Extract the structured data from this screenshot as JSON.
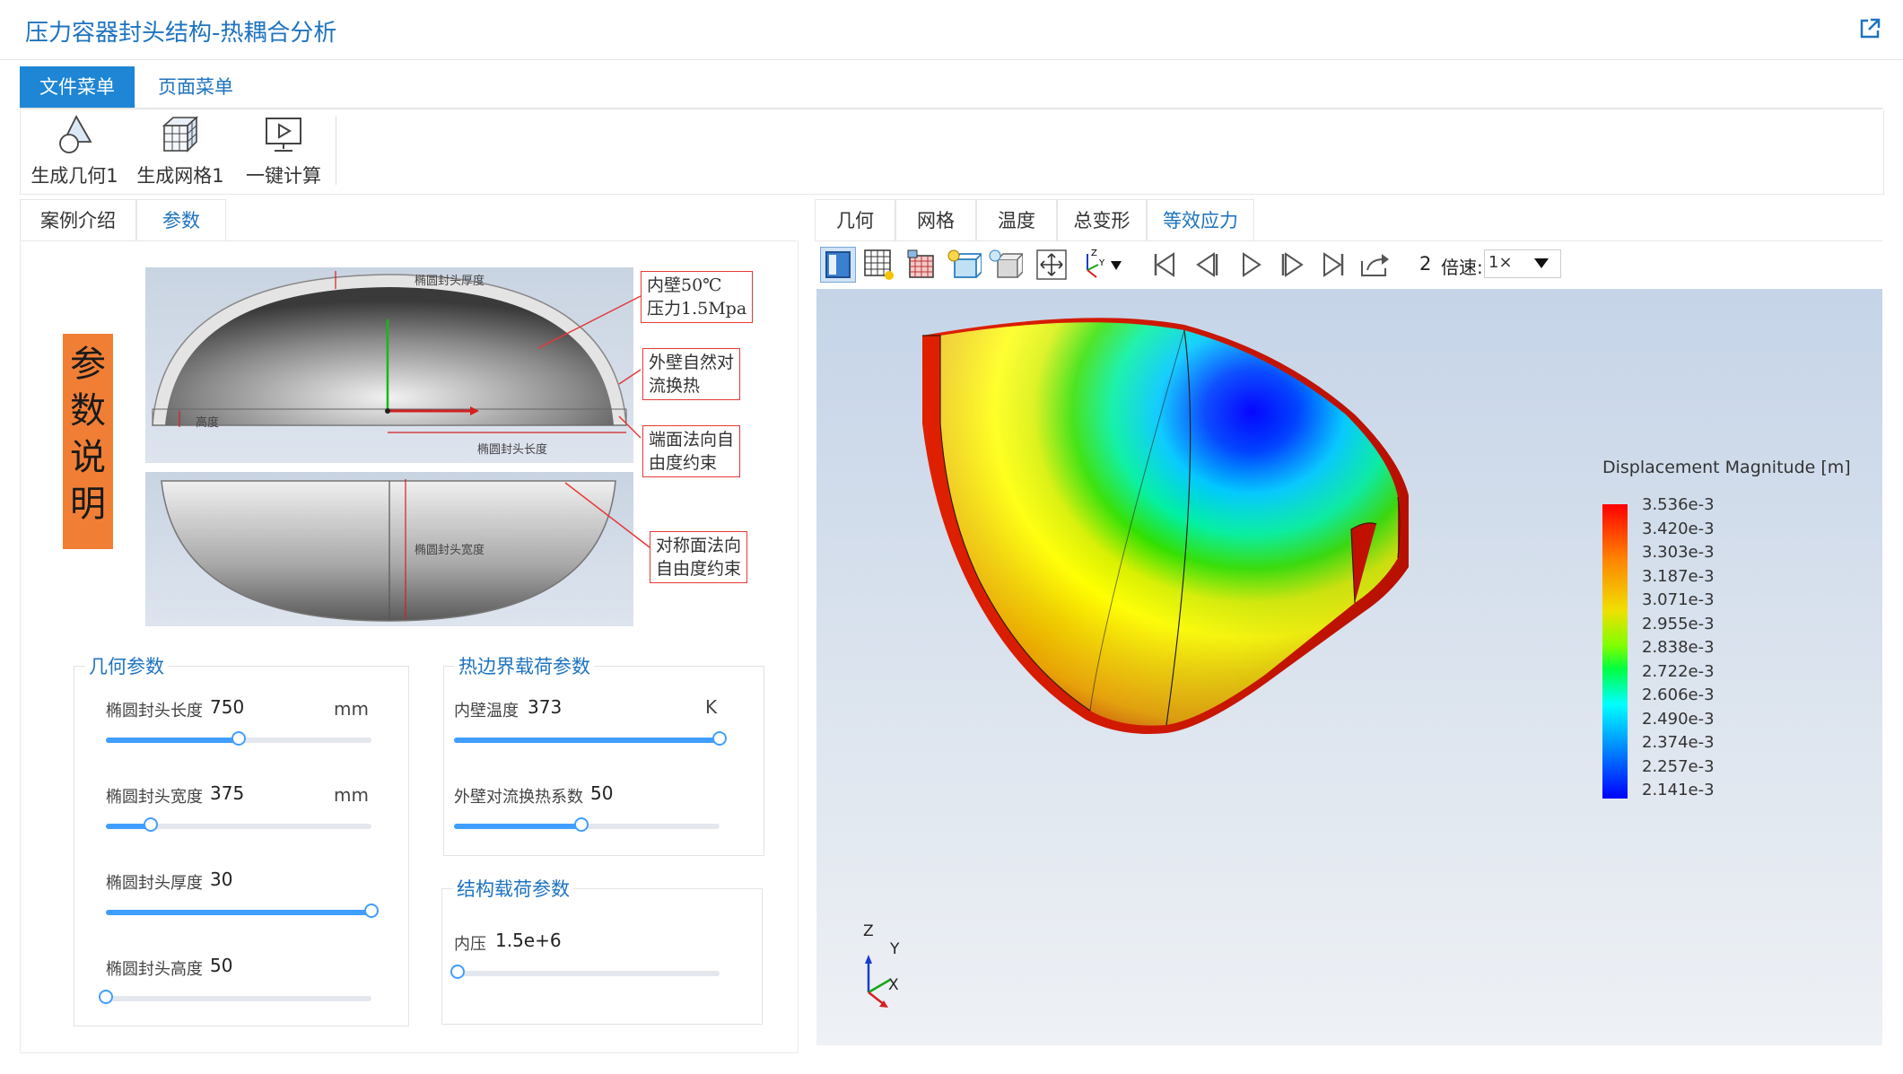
{
  "app": {
    "title": "压力容器封头结构-热耦合分析"
  },
  "menu_tabs": [
    {
      "label": "文件菜单",
      "active": true
    },
    {
      "label": "页面菜单",
      "active": false
    }
  ],
  "ribbon": [
    {
      "label": "生成几何1",
      "icon": "geometry-icon"
    },
    {
      "label": "生成网格1",
      "icon": "mesh-cube-icon"
    },
    {
      "label": "一键计算",
      "icon": "compute-monitor-icon"
    }
  ],
  "left_tabs": [
    {
      "label": "案例介绍",
      "active": false
    },
    {
      "label": "参数",
      "active": true
    }
  ],
  "param_description": {
    "badge": "参数说明",
    "badge_color": "#f07f35",
    "diagram_labels": {
      "thickness": "椭圆封头厚度",
      "height": "高度",
      "length": "椭圆封头长度",
      "width": "椭圆封头宽度"
    },
    "annotations": {
      "inner_wall": [
        "内壁50℃",
        "压力1.5Mpa"
      ],
      "outer_wall": [
        "外壁自然对",
        "流换热"
      ],
      "end_face": [
        "端面法向自",
        "由度约束"
      ],
      "symmetry": [
        "对称面法向",
        "自由度约束"
      ]
    }
  },
  "geometry_params": {
    "legend": "几何参数",
    "items": [
      {
        "label": "椭圆封头长度",
        "value": "750",
        "unit": "mm",
        "fraction": 0.5
      },
      {
        "label": "椭圆封头宽度",
        "value": "375",
        "unit": "mm",
        "fraction": 0.17
      },
      {
        "label": "椭圆封头厚度",
        "value": "30",
        "unit": "",
        "fraction": 1.0
      },
      {
        "label": "椭圆封头高度",
        "value": "50",
        "unit": "",
        "fraction": 0.0
      }
    ]
  },
  "thermal_params": {
    "legend": "热边界载荷参数",
    "items": [
      {
        "label": "内壁温度",
        "value": "373",
        "unit": "K",
        "fraction": 1.0
      },
      {
        "label": "外壁对流换热系数",
        "value": "50",
        "unit": "",
        "fraction": 0.48
      }
    ]
  },
  "structural_params": {
    "legend": "结构载荷参数",
    "items": [
      {
        "label": "内压",
        "value": "1.5e+6",
        "unit": "",
        "fraction": 0.0
      }
    ]
  },
  "result_tabs": [
    {
      "label": "几何",
      "active": false
    },
    {
      "label": "网格",
      "active": false
    },
    {
      "label": "温度",
      "active": false
    },
    {
      "label": "总变形",
      "active": false
    },
    {
      "label": "等效应力",
      "active": true
    }
  ],
  "toolbar": {
    "frame": "2",
    "speed_label": "倍速:",
    "speed_value": "1×",
    "icons": [
      "view-solid-icon",
      "mesh-grid-icon",
      "mesh-color-icon",
      "light-box-icon",
      "light-cube-icon",
      "fit-view-icon",
      "axes-dropdown-icon",
      "first-frame-icon",
      "prev-frame-icon",
      "play-icon",
      "next-frame-icon",
      "last-frame-icon",
      "export-icon"
    ]
  },
  "legend": {
    "title": "Displacement Magnitude [m]",
    "ticks": [
      "3.536e-3",
      "3.420e-3",
      "3.303e-3",
      "3.187e-3",
      "3.071e-3",
      "2.955e-3",
      "2.838e-3",
      "2.722e-3",
      "2.606e-3",
      "2.490e-3",
      "2.374e-3",
      "2.257e-3",
      "2.141e-3"
    ],
    "colors": [
      "#ff0000",
      "#ff8800",
      "#ffff00",
      "#00ff00",
      "#00ffff",
      "#0000ff"
    ]
  },
  "axes": {
    "z": "Z",
    "y": "Y",
    "x": "X"
  },
  "accent_color": "#1e73c0"
}
